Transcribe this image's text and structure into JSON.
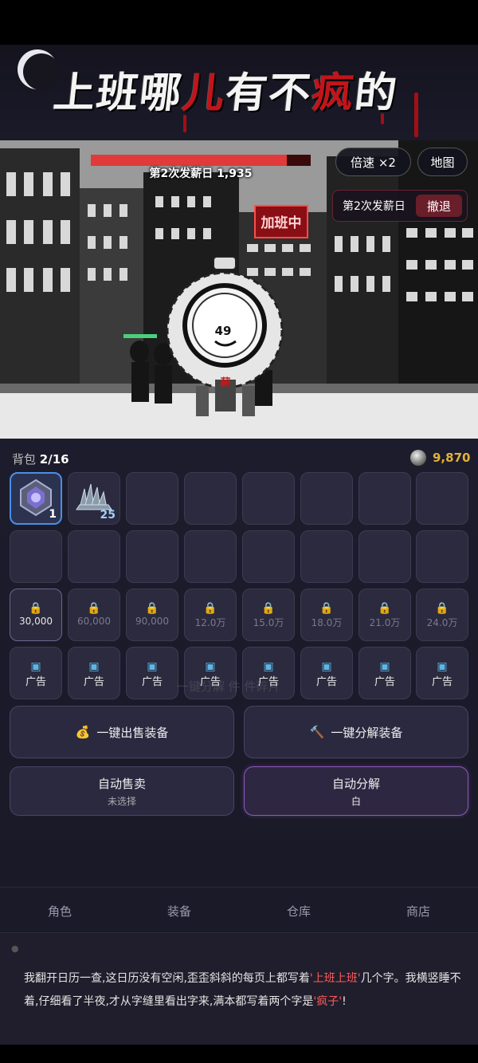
{
  "title": {
    "part1": "上班哪",
    "part2": "儿",
    "part3": "有不",
    "part4": "疯",
    "part5": "的"
  },
  "battle": {
    "hp_fraction": 0.89,
    "hp_label": "第2次发薪日  1,935",
    "speed_label": "倍速 ×2",
    "map_label": "地图",
    "payday_label": "第2次发薪日",
    "retreat_label": "撤退",
    "sign_text": "加班中",
    "boss_number": "49",
    "boss_tag": "薪"
  },
  "bag": {
    "label": "背包",
    "count": "2/16",
    "coins": "9,870",
    "items": [
      {
        "icon": "crystal-ore-icon",
        "count": "1"
      },
      {
        "icon": "scrap-pile-icon",
        "count": "25"
      }
    ],
    "locked_slots": [
      "30,000",
      "60,000",
      "90,000",
      "12.0万",
      "15.0万",
      "18.0万",
      "21.0万",
      "24.0万"
    ],
    "ad_label": "广告",
    "ghost_text": "一键分解 件 件碎片"
  },
  "actions": {
    "sell_all": "一键出售装备",
    "dismantle_all": "一键分解装备",
    "auto_sell": "自动售卖",
    "auto_sell_value": "未选择",
    "auto_dismantle": "自动分解",
    "auto_dismantle_value": "白"
  },
  "tabs": [
    "角色",
    "装备",
    "仓库",
    "商店"
  ],
  "story": {
    "t1": "我翻开日历一查,这日历没有空闲,歪歪斜斜的每页上都写着",
    "h1": "'上班上班'",
    "t2": "几个字。我横竖睡不着,仔细看了半夜,才从字缝里看出字来,满本都写着两个字是",
    "h2": "'疯子'",
    "t3": "!"
  },
  "colors": {
    "accent_red": "#e03a3a",
    "coin_gold": "#e0b23c",
    "select_blue": "#4a8fe8",
    "purple": "#8b5ab8"
  }
}
